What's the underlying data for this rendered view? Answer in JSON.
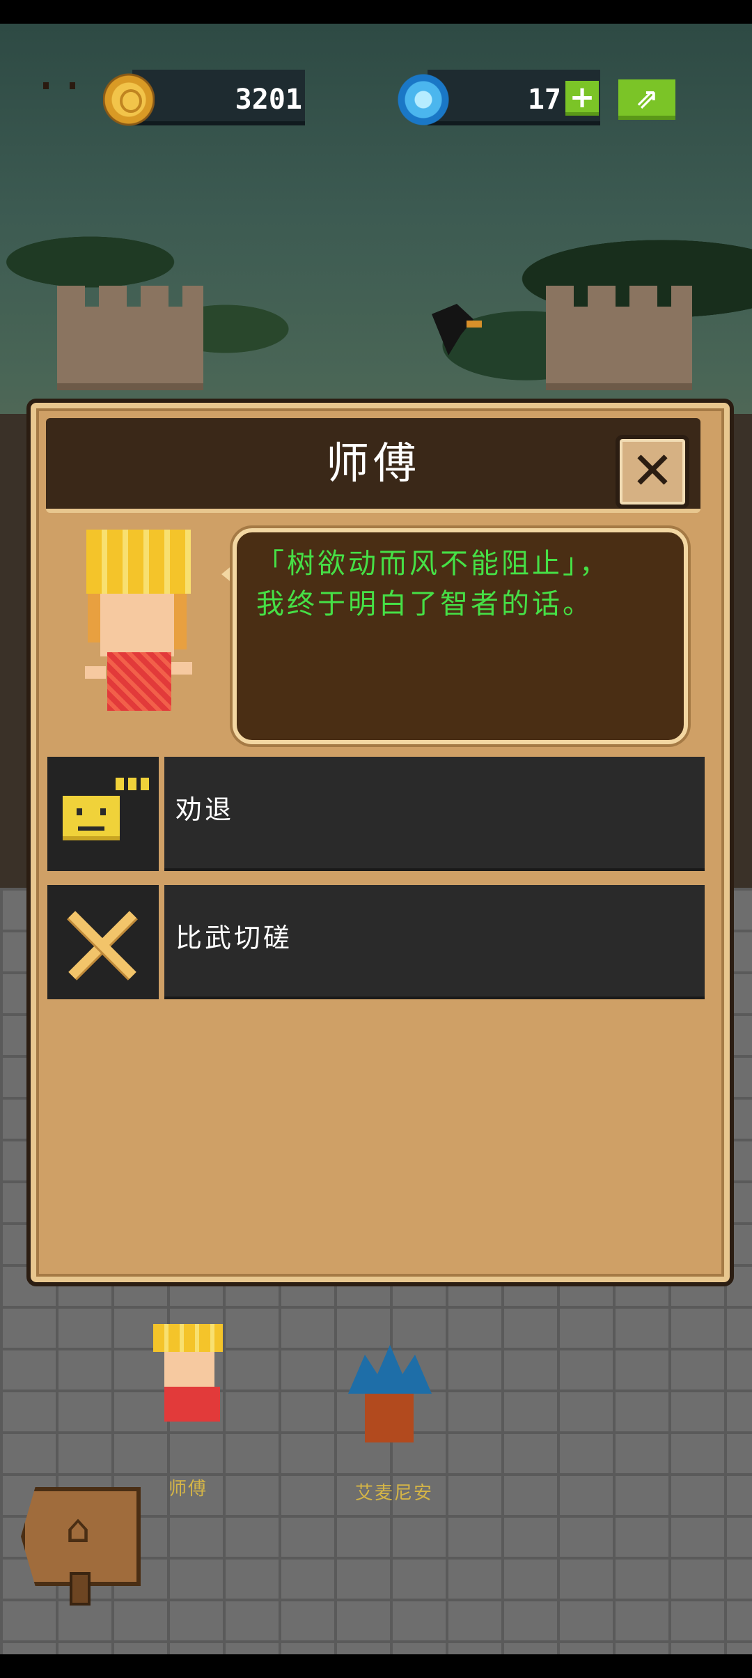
{
  "hud": {
    "coins": "3201",
    "gems": "17",
    "plus_label": "+",
    "share_icon": "share-icon"
  },
  "dialog": {
    "title": "师傅",
    "close_icon": "close-icon",
    "speech_line1": "「树欲动而风不能阻止」，",
    "speech_line2": "我终于明白了智者的话。",
    "options": [
      {
        "icon": "smiley-icon",
        "label": "劝退"
      },
      {
        "icon": "crossed-swords-icon",
        "label": "比武切磋"
      }
    ]
  },
  "background": {
    "characters": [
      "师傅",
      "艾麦尼安"
    ],
    "home_icon": "home-icon"
  },
  "colors": {
    "dialog_bg": "#cfa066",
    "speech_text": "#46e046",
    "accent_green": "#7bc427"
  }
}
